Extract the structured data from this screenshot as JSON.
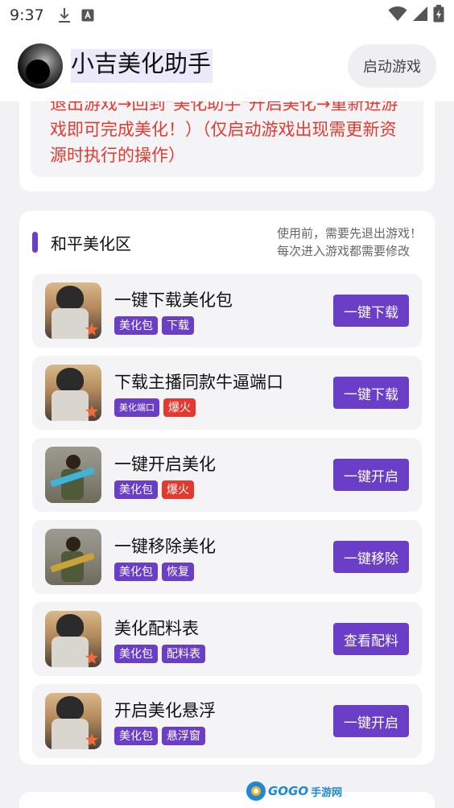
{
  "status_bar": {
    "time": "9:37",
    "icons": [
      "download-icon",
      "text-recognition-icon",
      "wifi-icon",
      "signal-icon",
      "battery-charging-icon"
    ]
  },
  "header": {
    "title": "小吉美化助手",
    "launch_label": "启动游戏"
  },
  "notice": {
    "text": "退出游戏→回到\"美化助手\"开启美化→重新进游戏即可完成美化！）（仅启动游戏出现需更新资源时执行的操作）"
  },
  "section": {
    "title": "和平美化区",
    "note_line1": "使用前，需要先退出游戏！",
    "note_line2": "每次进入游戏都需要修改",
    "items": [
      {
        "title": "一键下载美化包",
        "tags": [
          {
            "text": "美化包"
          },
          {
            "text": "下载"
          }
        ],
        "button": "一键下载"
      },
      {
        "title": "下载主播同款牛逼端口",
        "tags": [
          {
            "text": "美化端口"
          },
          {
            "text": "爆火"
          }
        ],
        "button": "一键下载"
      },
      {
        "title": "一键开启美化",
        "tags": [
          {
            "text": "美化包"
          },
          {
            "text": "爆火"
          }
        ],
        "button": "一键开启"
      },
      {
        "title": "一键移除美化",
        "tags": [
          {
            "text": "美化包"
          },
          {
            "text": "恢复"
          }
        ],
        "button": "一键移除"
      },
      {
        "title": "美化配料表",
        "tags": [
          {
            "text": "美化包"
          },
          {
            "text": "配料表"
          }
        ],
        "button": "查看配料"
      },
      {
        "title": "开启美化悬浮",
        "tags": [
          {
            "text": "美化包"
          },
          {
            "text": "悬浮窗"
          }
        ],
        "button": "一键开启"
      }
    ]
  },
  "watermark": {
    "brand": "GOGO",
    "cn": "手游网"
  },
  "colors": {
    "accent": "#6a3ec6",
    "warning": "#e3392f"
  }
}
